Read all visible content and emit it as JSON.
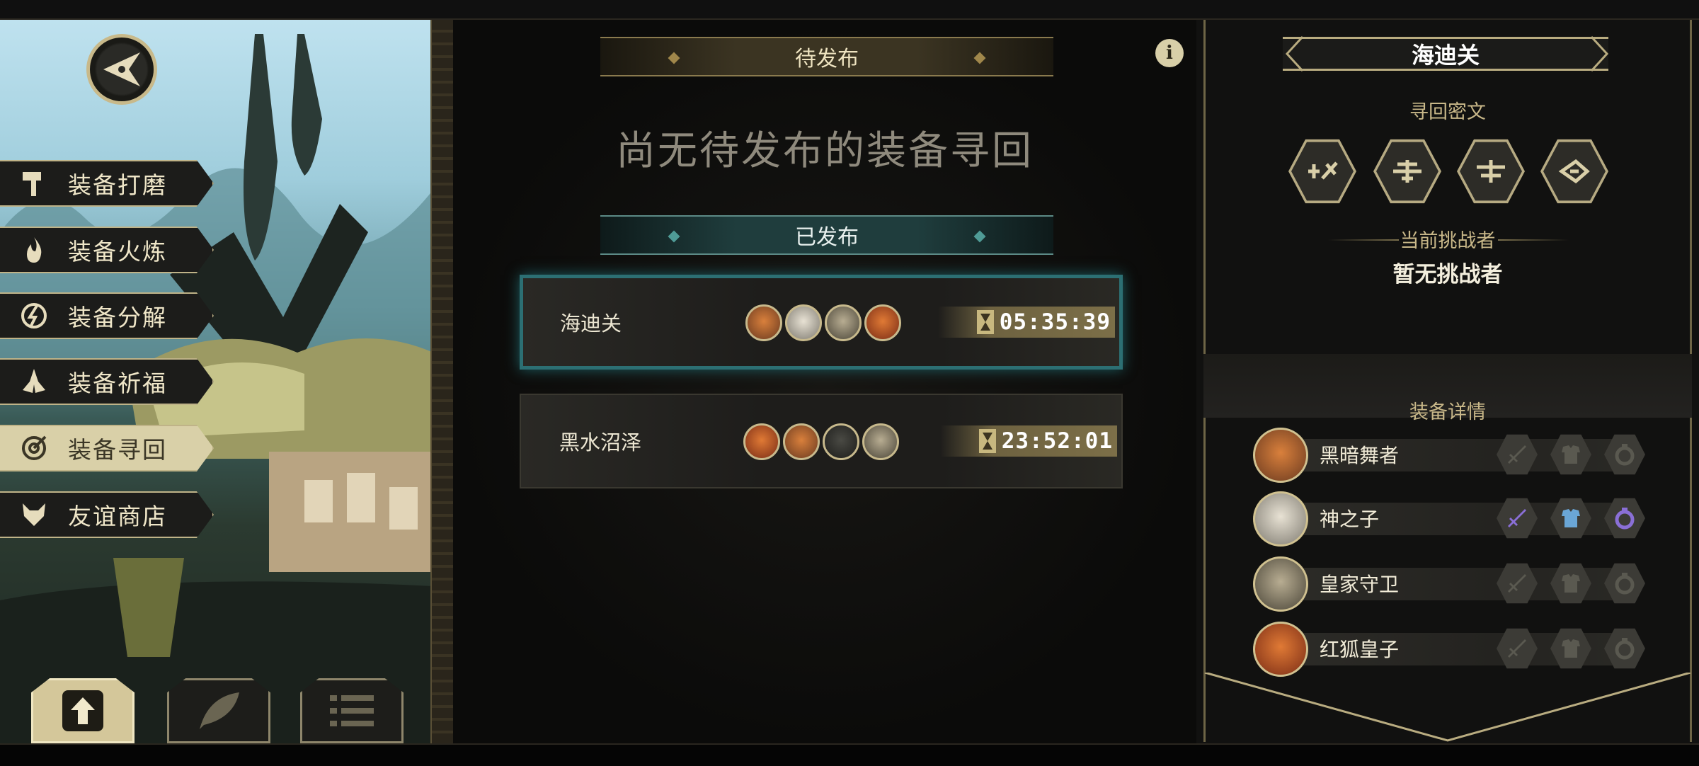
{
  "left_menu": {
    "items": [
      {
        "label": "装备打磨",
        "icon": "hammer-icon"
      },
      {
        "label": "装备火炼",
        "icon": "flame-icon"
      },
      {
        "label": "装备分解",
        "icon": "break-icon"
      },
      {
        "label": "装备祈福",
        "icon": "pray-hands-icon"
      },
      {
        "label": "装备寻回",
        "icon": "target-icon"
      },
      {
        "label": "友谊商店",
        "icon": "fox-icon"
      }
    ],
    "active_index": 4
  },
  "bottom_tabs": [
    {
      "icon": "publish-upload-icon"
    },
    {
      "icon": "feather-icon"
    },
    {
      "icon": "list-icon"
    }
  ],
  "center": {
    "pending_label": "待发布",
    "empty_message": "尚无待发布的装备寻回",
    "published_label": "已发布",
    "routes": [
      {
        "name": "海迪关",
        "timer": "05:35:39",
        "selected": true
      },
      {
        "name": "黑水沼泽",
        "timer": "23:52:01",
        "selected": false
      }
    ]
  },
  "info_icon": "i",
  "right_panel": {
    "title": "海迪关",
    "runes_label": "寻回密文",
    "challenger_label": "当前挑战者",
    "challenger_value": "暂无挑战者",
    "details_label": "装备详情",
    "heroes": [
      {
        "name": "黑暗舞者",
        "equipped": false
      },
      {
        "name": "神之子",
        "equipped": true
      },
      {
        "name": "皇家守卫",
        "equipped": false
      },
      {
        "name": "红狐皇子",
        "equipped": false
      }
    ]
  },
  "colors": {
    "gold": "#c8b98a",
    "teal": "#2c6f73",
    "equip_purple": "#8a6fd6",
    "equip_blue": "#6aa6d6"
  }
}
